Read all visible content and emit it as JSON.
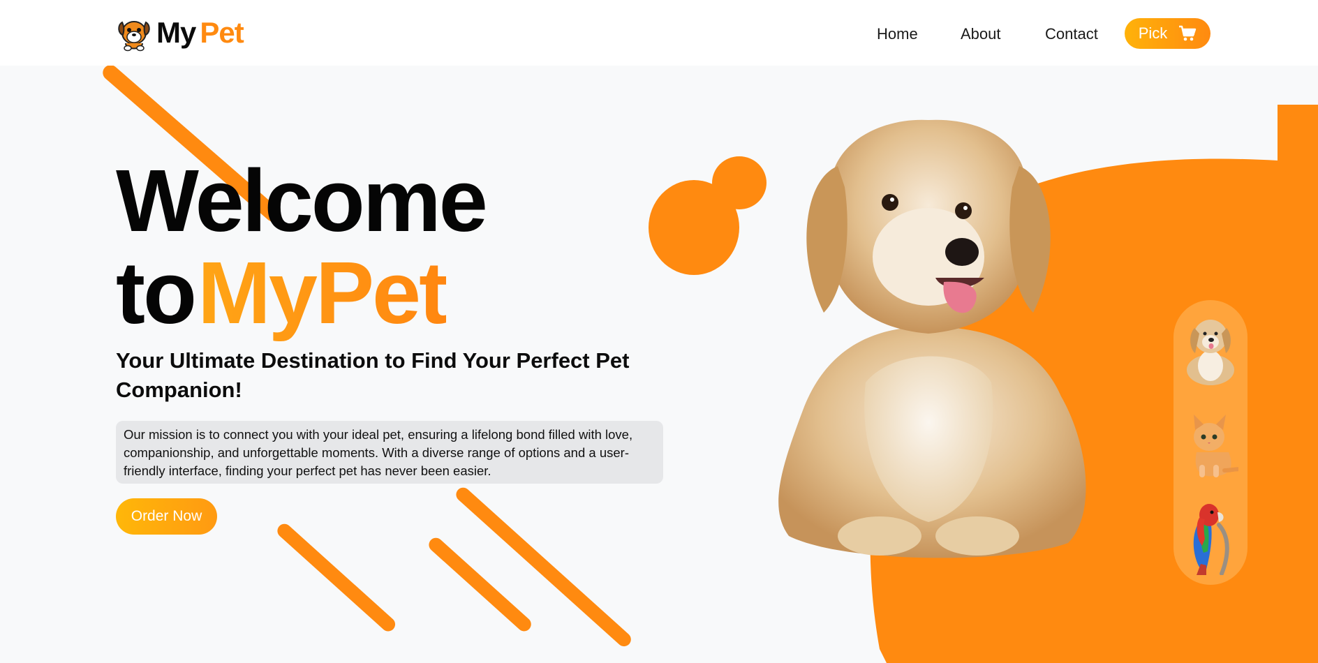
{
  "header": {
    "logo": {
      "my": "My",
      "pet": "Pet"
    },
    "nav": [
      {
        "label": "Home"
      },
      {
        "label": "About"
      },
      {
        "label": "Contact"
      }
    ],
    "pick_button": {
      "label": "Pick",
      "icon": "cart-icon"
    }
  },
  "hero": {
    "title_line1": "Welcome",
    "title_line2_prefix": "to",
    "title_line2_brand": "MyPet",
    "subtitle": "Your Ultimate Destination to Find Your Perfect Pet Companion!",
    "mission": "Our mission is to connect you with your ideal pet, ensuring a lifelong bond filled with love, companionship, and unforgettable moments. With a diverse range of options and a user-friendly interface, finding your perfect pet has never been easier.",
    "order_button": "Order Now"
  },
  "pets": [
    {
      "icon": "puppy-thumbnail"
    },
    {
      "icon": "kitten-thumbnail"
    },
    {
      "icon": "parrot-thumbnail"
    }
  ],
  "colors": {
    "accent": "#ff8a10",
    "accent_light": "#ffb20a",
    "background": "#f8f9fa",
    "mission_bg": "#e6e7e9"
  }
}
